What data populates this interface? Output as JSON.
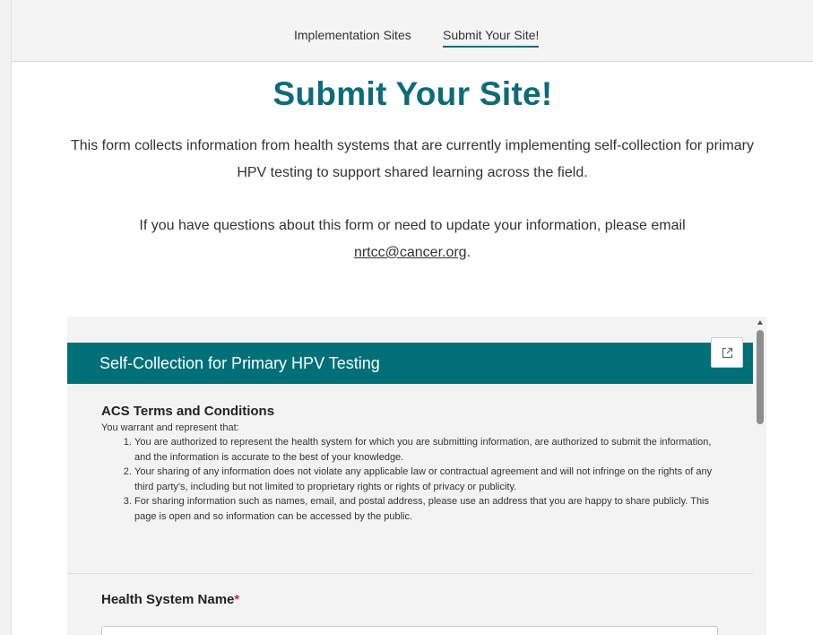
{
  "nav": {
    "items": [
      {
        "label": "Implementation Sites"
      },
      {
        "label": "Submit Your Site!"
      }
    ]
  },
  "page_title": "Submit Your Site!",
  "intro": "This form collects information from health systems that are currently implementing self-collection for primary HPV testing to support shared learning across the field.",
  "contact": {
    "text": "If you have questions about this form or need to update your information, please email",
    "email": "nrtcc@cancer.org",
    "end": "."
  },
  "form": {
    "header_title": "Self-Collection for Primary HPV Testing",
    "popout_icon": "open-in-new-icon",
    "terms_heading": "ACS Terms and Conditions",
    "terms_intro": "You warrant and represent that:",
    "terms": [
      "You are authorized to represent the health system for which you are submitting information, are authorized to submit the information, and the information is accurate to the best of your knowledge.",
      "Your sharing of any information does not violate any applicable law or contractual agreement and will not infringe on the rights of any third party's, including but not limited to proprietary rights or rights of privacy or publicity.",
      "For sharing information such as names, email, and postal address, please use an address that you are happy to share publicly. This page is open and so information can be accessed by the public."
    ],
    "field_label": "Health System Name",
    "required_mark": "*",
    "field_value": ""
  },
  "colors": {
    "accent": "#0d6b78",
    "header_bg": "#007078",
    "required": "#c0392b"
  }
}
